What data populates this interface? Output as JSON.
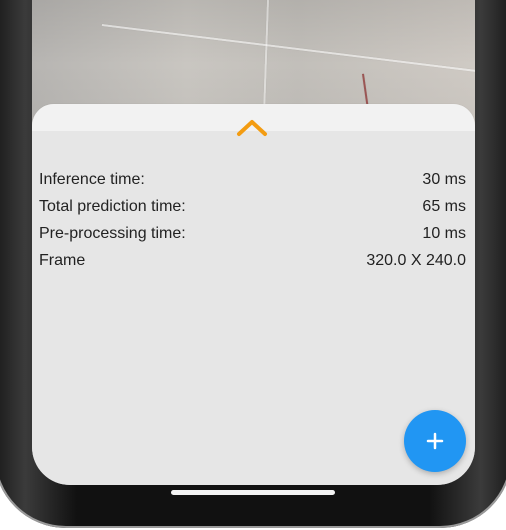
{
  "bottom_sheet": {
    "expand_icon": "chevron-up-icon",
    "rows": [
      {
        "label": "Inference time:",
        "value": "30 ms"
      },
      {
        "label": "Total prediction time:",
        "value": "65 ms"
      },
      {
        "label": "Pre-processing time:",
        "value": "10 ms"
      },
      {
        "label": "Frame",
        "value": "320.0 X 240.0"
      }
    ]
  },
  "fab": {
    "icon": "plus-icon",
    "color": "#2196f3"
  },
  "accent_color": "#f39c12"
}
